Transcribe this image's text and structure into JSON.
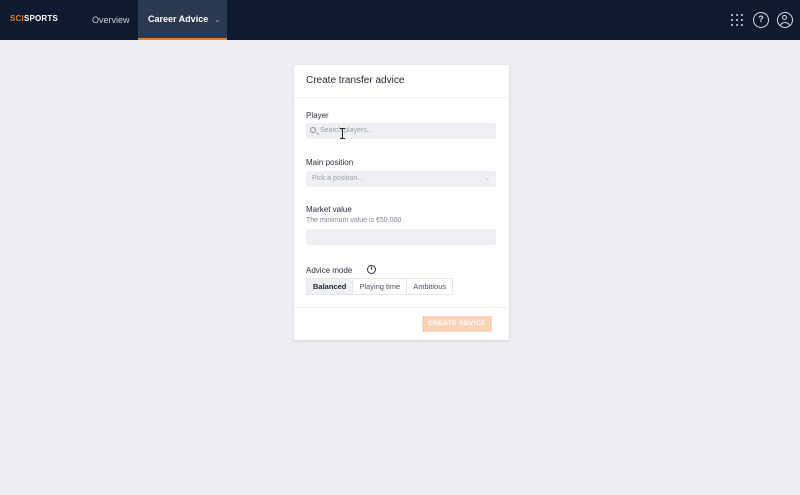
{
  "app": {
    "logo_part1": "SCI",
    "logo_part2": "SPORTS",
    "brand_color": "#f07c22"
  },
  "nav": {
    "tabs": [
      {
        "label": "Overview",
        "active": false
      },
      {
        "label": "Career Advice",
        "active": true,
        "icon": "chevron-down-icon"
      }
    ],
    "right_icons": [
      "apps-grid-icon",
      "help-icon",
      "user-account-icon"
    ]
  },
  "form": {
    "title": "Create transfer advice",
    "player": {
      "label": "Player",
      "placeholder": "Search players..."
    },
    "main_position": {
      "label": "Main position",
      "placeholder": "Pick a position..."
    },
    "market_value": {
      "label": "Market value",
      "helper": "The minimum value is €50.000",
      "value": ""
    },
    "advice_mode": {
      "label": "Advice mode",
      "options": [
        "Balanced",
        "Playing time",
        "Ambitious"
      ],
      "selected": "Balanced"
    },
    "submit_label": "CREATE ADVICE"
  }
}
